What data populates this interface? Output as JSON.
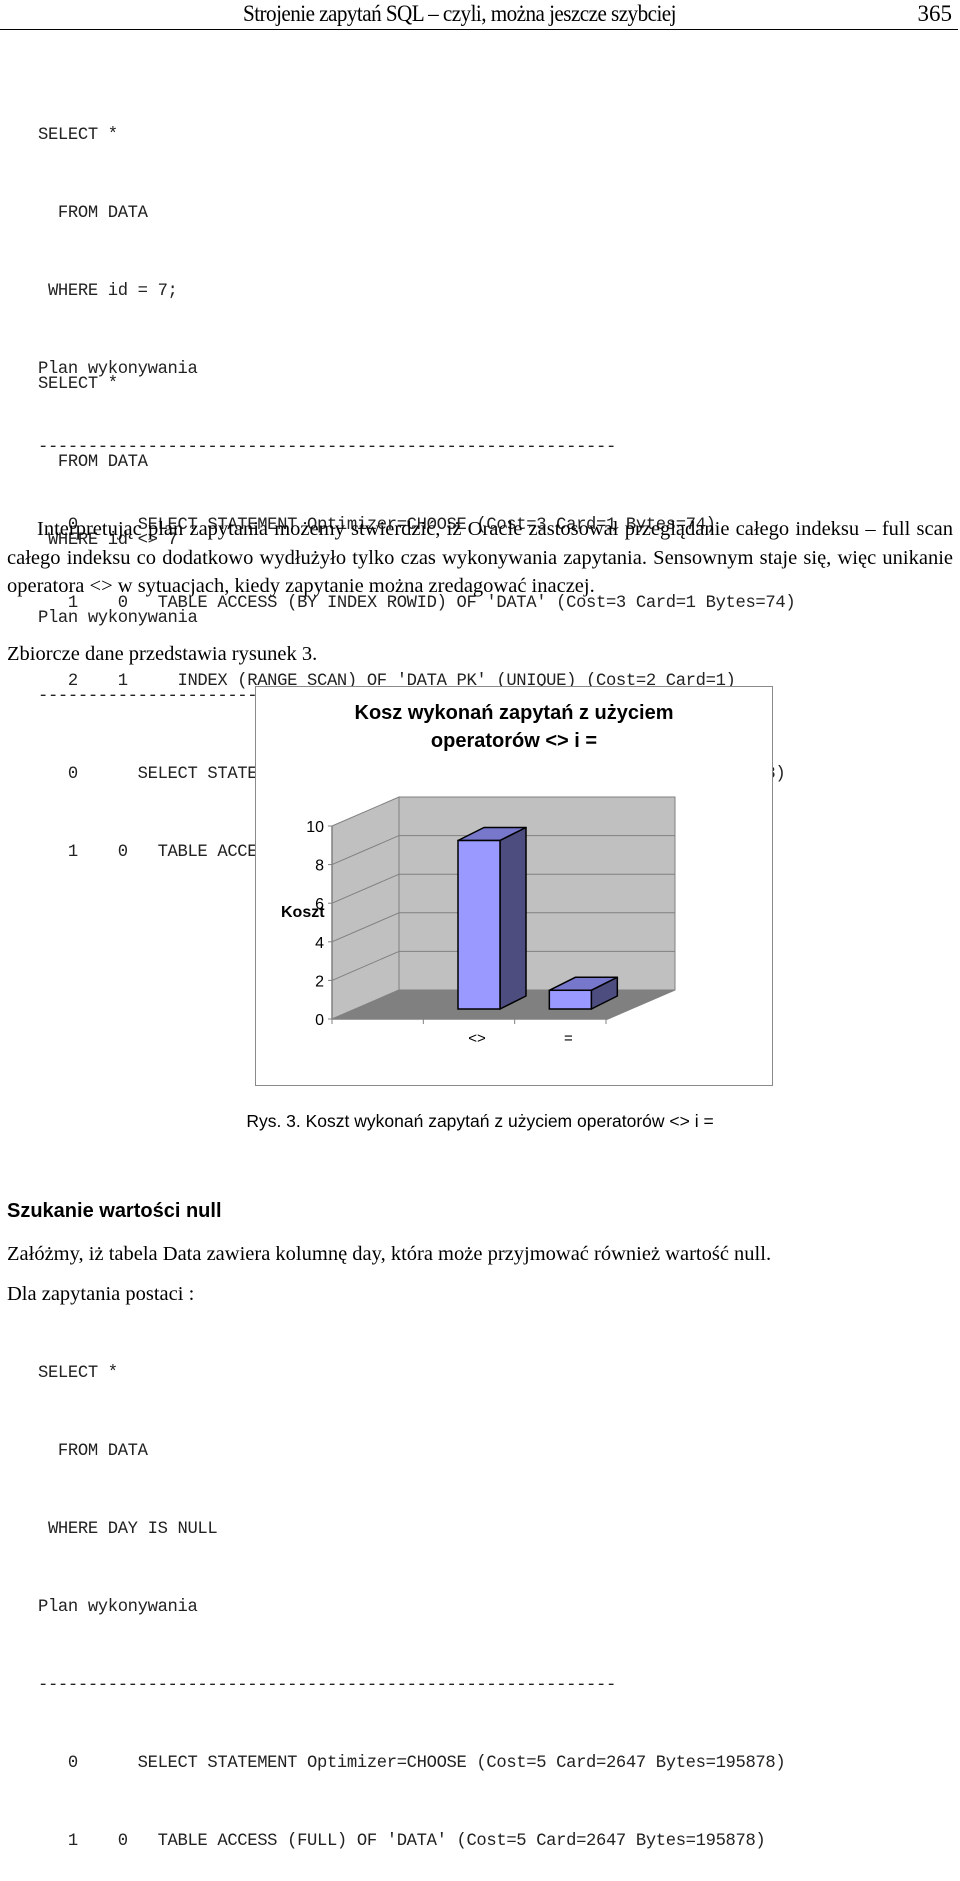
{
  "header": {
    "title": "Strojenie zapytań SQL – czyli, można jeszcze szybciej",
    "page_number": "365"
  },
  "code_block_1": {
    "lines": [
      "SELECT *",
      "  FROM DATA",
      " WHERE id = 7;",
      "Plan wykonywania",
      "----------------------------------------------------------",
      "   0      SELECT STATEMENT Optimizer=CHOOSE (Cost=3 Card=1 Bytes=74)",
      "   1    0   TABLE ACCESS (BY INDEX ROWID) OF 'DATA' (Cost=3 Card=1 Bytes=74)",
      "   2    1     INDEX (RANGE SCAN) OF 'DATA_PK' (UNIQUE) (Cost=2 Card=1)"
    ]
  },
  "code_block_2": {
    "lines": [
      "SELECT *",
      "  FROM DATA",
      " WHERE id <> 7",
      "Plan wykonywania",
      "----------------------------------------------------------",
      "   0      SELECT STATEMENT Optimizer=CHOOSE (Cost=5 Card=2647 Bytes=195878)",
      "   1    0   TABLE ACCESS (FULL) OF 'DATA' (Cost=5 Card=2647 Bytes=195878)"
    ]
  },
  "paragraphs": {
    "interpretation": "Interpretując plan zapytania możemy stwierdzić, iż Oracle zastosował przeglądanie całego indeksu – full scan całego indeksu co dodatkowo wydłużyło tylko czas wykonywania zapytania. Sensownym staje się, więc unikanie operatora <> w sytuacjach, kiedy zapytanie można zredagować inaczej.",
    "summary": "Zbiorcze dane przedstawia rysunek 3."
  },
  "chart_data": {
    "type": "bar",
    "style": "3d-column",
    "title_lines": [
      "Kosz wykonań zapytań z użyciem",
      "operatorów <> i ="
    ],
    "categories": [
      "<>",
      "="
    ],
    "values": [
      9,
      1
    ],
    "xlabel": "",
    "ylabel": "Koszt",
    "ylim": [
      0,
      10
    ],
    "yticks": [
      "0",
      "2",
      "4",
      "6",
      "8",
      "10"
    ],
    "grid": true,
    "legend": "none",
    "colors": {
      "bar_front": "#9999ff",
      "bar_top": "#7777cc",
      "bar_side": "#4d4d80",
      "wall": "#c0c0c0",
      "floor": "#808080"
    }
  },
  "caption": "Rys. 3. Koszt wykonań zapytań z użyciem operatorów <> i =",
  "section": {
    "heading": "Szukanie wartości null",
    "intro": "Załóżmy, iż tabela Data zawiera kolumnę day, która może przyjmować również wartość null.",
    "lead": "Dla zapytania postaci :"
  },
  "code_block_3": {
    "lines": [
      "SELECT *",
      "  FROM DATA",
      " WHERE DAY IS NULL",
      "Plan wykonywania",
      "----------------------------------------------------------",
      "   0      SELECT STATEMENT Optimizer=CHOOSE (Cost=5 Card=2647 Bytes=195878)",
      "   1    0   TABLE ACCESS (FULL) OF 'DATA' (Cost=5 Card=2647 Bytes=195878)"
    ]
  }
}
